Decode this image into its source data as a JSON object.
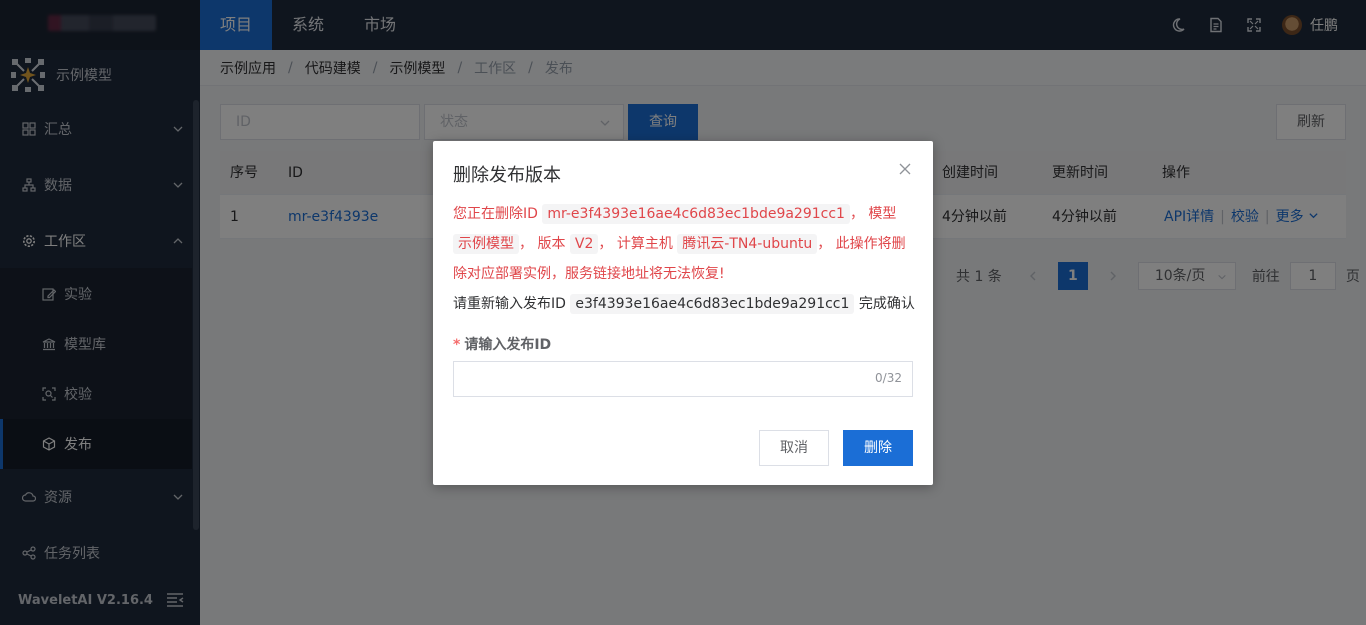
{
  "topnav": {
    "items": [
      "项目",
      "系统",
      "市场"
    ],
    "active": "项目"
  },
  "user": {
    "name": "任鹏"
  },
  "sidebar": {
    "app_name": "示例模型",
    "items": [
      "汇总",
      "数据",
      "工作区",
      "资源",
      "任务列表"
    ],
    "workspace_sub": [
      "实验",
      "模型库",
      "校验",
      "发布"
    ],
    "active_sub": "发布",
    "version": "WaveletAI V2.16.4"
  },
  "breadcrumb": [
    "示例应用",
    "代码建模",
    "示例模型",
    "工作区",
    "发布"
  ],
  "filters": {
    "id_placeholder": "ID",
    "status_placeholder": "状态",
    "query_label": "查询",
    "refresh_label": "刷新"
  },
  "table": {
    "headers": [
      "序号",
      "ID",
      "创建时间",
      "更新时间",
      "操作"
    ],
    "rows": [
      {
        "index": "1",
        "id": "mr-e3f4393e",
        "created": "4分钟以前",
        "updated": "4分钟以前"
      }
    ],
    "actions": {
      "api": "API详情",
      "verify": "校验",
      "more": "更多"
    }
  },
  "pagination": {
    "total": "共 1 条",
    "page": "1",
    "page_size": "10条/页",
    "goto_prefix": "前往",
    "goto_value": "1",
    "goto_suffix": "页"
  },
  "dialog": {
    "title": "删除发布版本",
    "w1": "您正在删除ID",
    "release_id": "mr-e3f4393e16ae4c6d83ec1bde9a291cc1",
    "comma1": "，",
    "w2": "模型",
    "model_name": "示例模型",
    "comma2": "，",
    "w3": "版本",
    "version": "V2",
    "comma3": "，",
    "w4": "计算主机",
    "host": "腾讯云-TN4-ubuntu",
    "comma4": "，",
    "w5": "此操作将删除对应部署实例，服务链接地址将无法恢复!",
    "confirm_prefix": "请重新输入发布ID",
    "confirm_id": "e3f4393e16ae4c6d83ec1bde9a291cc1",
    "confirm_suffix": "完成确认",
    "field_label": "请输入发布ID",
    "char_count": "0/32",
    "cancel_label": "取消",
    "delete_label": "删除"
  },
  "colors": {
    "primary": "#1b6ed6",
    "danger_text": "#e0464a",
    "sidebar_bg": "#1f2b3c"
  }
}
